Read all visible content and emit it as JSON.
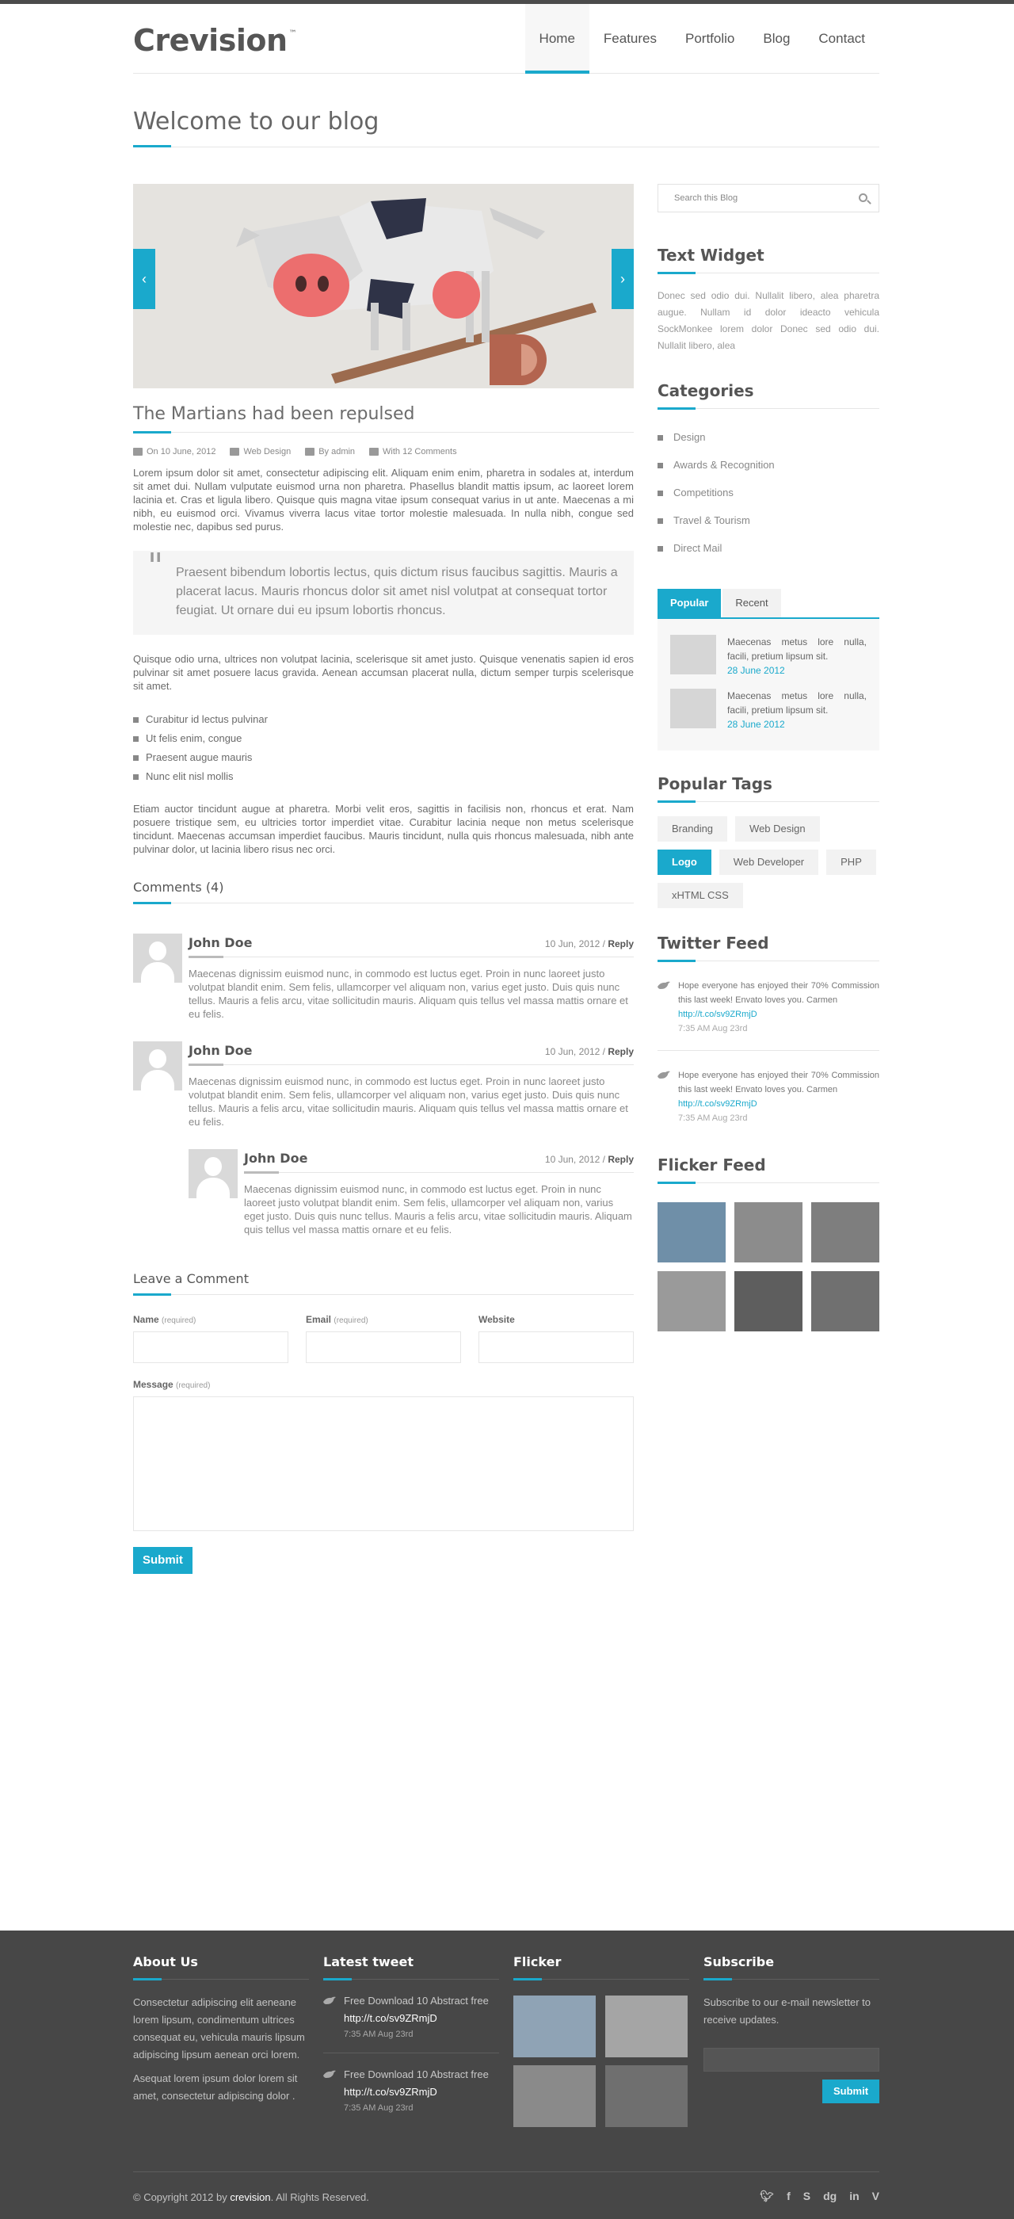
{
  "header": {
    "logo": "Crevision",
    "logo_tm": "™",
    "nav": [
      "Home",
      "Features",
      "Portfolio",
      "Blog",
      "Contact"
    ],
    "active_nav": "Home"
  },
  "page_title": "Welcome to our blog",
  "post": {
    "title": "The Martians had been repulsed",
    "meta": {
      "date": "On 10 June, 2012",
      "category": "Web Design",
      "author": "By admin",
      "comments": "With 12 Comments"
    },
    "para1": "Lorem ipsum dolor sit amet, consectetur adipiscing elit. Aliquam enim enim, pharetra in sodales at, interdum sit amet dui. Nullam vulputate euismod urna non pharetra. Phasellus blandit mattis ipsum, ac laoreet lorem lacinia et. Cras et ligula libero. Quisque quis magna vitae ipsum consequat varius in ut ante. Maecenas a mi nibh, eu euismod orci. Vivamus viverra lacus vitae tortor molestie malesuada. In nulla nibh, congue sed molestie nec, dapibus sed purus.",
    "quote_mark": "\"",
    "quote": "Praesent bibendum lobortis lectus, quis dictum risus faucibus sagittis. Mauris a placerat lacus. Mauris rhoncus dolor sit amet nisl volutpat at consequat tortor feugiat. Ut ornare dui eu ipsum lobortis rhoncus.",
    "para2": "Quisque odio urna, ultrices non volutpat lacinia, scelerisque sit amet justo. Quisque venenatis sapien id eros pulvinar sit amet posuere lacus gravida. Aenean accumsan placerat nulla, dictum semper turpis scelerisque sit amet.",
    "list": [
      "Curabitur id lectus pulvinar",
      "Ut felis enim, congue",
      "Praesent augue mauris",
      "Nunc elit nisl mollis"
    ],
    "para3": "Etiam auctor tincidunt augue at pharetra. Morbi velit eros, sagittis in facilisis non, rhoncus et erat. Nam posuere tristique sem, eu ultricies tortor imperdiet vitae. Curabitur lacinia neque non metus scelerisque tincidunt. Maecenas accumsan imperdiet faucibus. Mauris tincidunt, nulla quis rhoncus malesuada, nibh ante pulvinar dolor, ut lacinia libero risus nec orci."
  },
  "slider": {
    "prev": "‹",
    "next": "›"
  },
  "comments": {
    "title": "Comments (4)",
    "items": [
      {
        "name": "John Doe",
        "date": "10 Jun, 2012 /",
        "reply": "Reply",
        "text": "Maecenas dignissim euismod nunc, in commodo est luctus eget. Proin in nunc laoreet justo volutpat blandit enim. Sem felis, ullamcorper vel aliquam non, varius eget justo. Duis quis nunc tellus. Mauris a felis arcu, vitae sollicitudin mauris. Aliquam quis tellus vel massa mattis ornare et eu felis."
      },
      {
        "name": "John Doe",
        "date": "10 Jun, 2012 /",
        "reply": "Reply",
        "text": "Maecenas dignissim euismod nunc, in commodo est luctus eget. Proin in nunc laoreet justo volutpat blandit enim. Sem felis, ullamcorper vel aliquam non, varius eget justo. Duis quis nunc tellus. Mauris a felis arcu, vitae sollicitudin mauris. Aliquam quis tellus vel massa mattis ornare et eu felis."
      },
      {
        "name": "John Doe",
        "date": "10 Jun, 2012 /",
        "reply": "Reply",
        "text": "Maecenas dignissim euismod nunc, in commodo est luctus eget. Proin in nunc laoreet justo volutpat blandit enim. Sem felis, ullamcorper vel aliquam non, varius eget justo. Duis quis nunc tellus. Mauris a felis arcu, vitae sollicitudin mauris. Aliquam quis tellus vel massa mattis ornare et eu felis."
      }
    ]
  },
  "form": {
    "title": "Leave a Comment",
    "name_label": "Name",
    "email_label": "Email",
    "website_label": "Website",
    "message_label": "Message",
    "required": "(required)",
    "submit": "Submit"
  },
  "sidebar": {
    "search_placeholder": "Search this Blog",
    "text_widget_title": "Text Widget",
    "text_widget_body": "Donec sed odio dui. Nullalit libero, alea pharetra augue. Nullam id dolor ideacto vehicula SockMonkee lorem dolor Donec sed odio dui. Nullalit libero, alea",
    "categories_title": "Categories",
    "categories": [
      "Design",
      "Awards & Recognition",
      "Competitions",
      "Travel & Tourism",
      "Direct Mail"
    ],
    "tabs": [
      "Popular",
      "Recent"
    ],
    "popular": [
      {
        "text": "Maecenas metus lore nulla, facili, pretium lipsum sit.",
        "date": "28 June 2012"
      },
      {
        "text": "Maecenas metus lore nulla, facili, pretium lipsum sit.",
        "date": "28 June 2012"
      }
    ],
    "tags_title": "Popular Tags",
    "tags": [
      "Branding",
      "Web Design",
      "Logo",
      "Web Developer",
      "PHP",
      "xHTML CSS"
    ],
    "active_tag": "Logo",
    "twitter_title": "Twitter Feed",
    "tweets": [
      {
        "text": "Hope everyone has enjoyed their 70% Commission this last week! Envato loves you. Carmen",
        "link": "http://t.co/sv9ZRmjD",
        "time": "7:35 AM Aug 23rd"
      },
      {
        "text": "Hope everyone has enjoyed their 70% Commission this last week! Envato loves you. Carmen",
        "link": "http://t.co/sv9ZRmjD",
        "time": "7:35 AM Aug 23rd"
      }
    ],
    "flicker_title": "Flicker Feed"
  },
  "footer": {
    "about_title": "About Us",
    "about_text1": "Consectetur adipiscing elit aeneane lorem lipsum, condimentum ultrices consequat eu, vehicula mauris lipsum adipiscing lipsum aenean orci lorem.",
    "about_text2": "Asequat lorem ipsum dolor lorem sit amet, consectetur adipiscing dolor .",
    "tweet_title": "Latest tweet",
    "tweets": [
      {
        "text": "Free Download 10 Abstract free",
        "link": "http://t.co/sv9ZRmjD",
        "time": "7:35 AM Aug 23rd"
      },
      {
        "text": "Free Download 10 Abstract free",
        "link": "http://t.co/sv9ZRmjD",
        "time": "7:35 AM Aug 23rd"
      }
    ],
    "flickr_title": "Flicker",
    "subscribe_title": "Subscribe",
    "subscribe_text": "Subscribe to our e-mail newsletter to receive updates.",
    "subscribe_button": "Submit",
    "copyright_pre": "© Copyright 2012 by",
    "copyright_brand": "crevision",
    "copyright_post": ". All Rights Reserved.",
    "social": [
      "twitter-icon",
      "facebook-icon",
      "skype-icon",
      "digg-icon",
      "linkedin-icon",
      "vimeo-icon"
    ]
  },
  "colors": {
    "accent": "#1aa9cc",
    "footer_bg": "#474747",
    "text": "#6b6b6b"
  }
}
